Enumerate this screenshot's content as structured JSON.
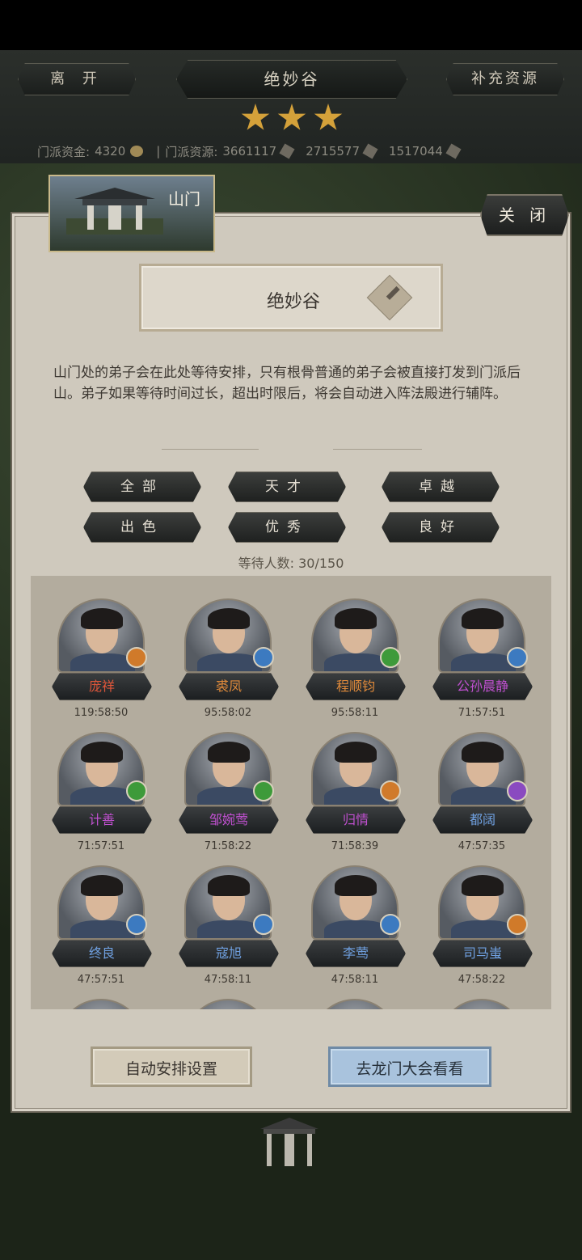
{
  "header": {
    "leave_label": "离 开",
    "title": "绝妙谷",
    "supply_label": "补充资源",
    "stars": 3,
    "resources": {
      "funds_label": "门派资金:",
      "funds_value": "4320",
      "resource_label": "门派资源:",
      "resource_value": "3661117",
      "res2_value": "2715577",
      "res3_value": "1517044",
      "sep": "|"
    }
  },
  "panel": {
    "tab_label": "山门",
    "close_label": "关 闭",
    "sect_name": "绝妙谷",
    "description": "山门处的弟子会在此处等待安排，只有根骨普通的弟子会被直接打发到门派后山。弟子如果等待时间过长，超出时限后，将会自动进入阵法殿进行辅阵。",
    "filters": [
      "全部",
      "天才",
      "卓越",
      "出色",
      "优秀",
      "良好"
    ],
    "waiting_label": "等待人数:",
    "waiting_value": "30/150",
    "disciples": [
      {
        "name": "庞祥",
        "time": "119:58:50",
        "color": "#e0563a",
        "badge": "#d07a2a"
      },
      {
        "name": "裘凤",
        "time": "95:58:02",
        "color": "#e08a3a",
        "badge": "#3c7ac0"
      },
      {
        "name": "程顺钧",
        "time": "95:58:11",
        "color": "#e08a3a",
        "badge": "#3e9a3a"
      },
      {
        "name": "公孙晨静",
        "time": "71:57:51",
        "color": "#c050d0",
        "badge": "#3c7ac0"
      },
      {
        "name": "计善",
        "time": "71:57:51",
        "color": "#c050d0",
        "badge": "#3e9a3a"
      },
      {
        "name": "邹婉莺",
        "time": "71:58:22",
        "color": "#c050d0",
        "badge": "#3e9a3a"
      },
      {
        "name": "归情",
        "time": "71:58:39",
        "color": "#c050d0",
        "badge": "#d07a2a"
      },
      {
        "name": "都阔",
        "time": "47:57:35",
        "color": "#6fa0e0",
        "badge": "#8a4ac0"
      },
      {
        "name": "终良",
        "time": "47:57:51",
        "color": "#6fa0e0",
        "badge": "#3c7ac0"
      },
      {
        "name": "寇旭",
        "time": "47:58:11",
        "color": "#6fa0e0",
        "badge": "#3c7ac0"
      },
      {
        "name": "李莺",
        "time": "47:58:11",
        "color": "#6fa0e0",
        "badge": "#3c7ac0"
      },
      {
        "name": "司马蚩",
        "time": "47:58:22",
        "color": "#6fa0e0",
        "badge": "#d07a2a"
      }
    ],
    "auto_label": "自动安排设置",
    "go_label": "去龙门大会看看"
  }
}
